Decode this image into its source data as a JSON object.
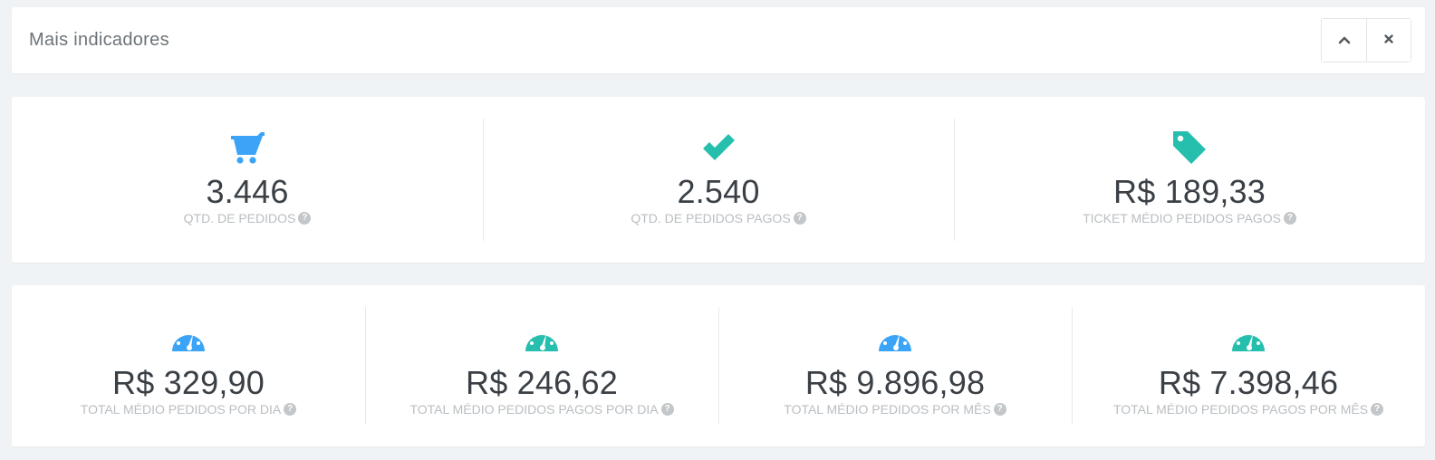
{
  "header": {
    "title": "Mais indicadores",
    "collapse_icon": "chevron-up-icon",
    "close_icon": "close-icon"
  },
  "colors": {
    "blue": "#3ba4f6",
    "teal": "#26bfae"
  },
  "row1": [
    {
      "icon": "cart-icon",
      "value": "3.446",
      "label": "QTD. DE PEDIDOS",
      "help": "?"
    },
    {
      "icon": "check-icon",
      "value": "2.540",
      "label": "QTD. DE PEDIDOS PAGOS",
      "help": "?"
    },
    {
      "icon": "tag-icon",
      "value": "R$ 189,33",
      "label": "TICKET MÉDIO PEDIDOS PAGOS",
      "help": "?"
    }
  ],
  "row2": [
    {
      "icon": "dashboard-icon",
      "value": "R$ 329,90",
      "label": "TOTAL MÉDIO PEDIDOS POR DIA",
      "help": "?"
    },
    {
      "icon": "dashboard-icon",
      "value": "R$ 246,62",
      "label": "TOTAL MÉDIO PEDIDOS PAGOS POR DIA",
      "help": "?"
    },
    {
      "icon": "dashboard-icon",
      "value": "R$ 9.896,98",
      "label": "TOTAL MÉDIO PEDIDOS POR MÊS",
      "help": "?"
    },
    {
      "icon": "dashboard-icon",
      "value": "R$ 7.398,46",
      "label": "TOTAL MÉDIO PEDIDOS PAGOS POR MÊS",
      "help": "?"
    }
  ]
}
